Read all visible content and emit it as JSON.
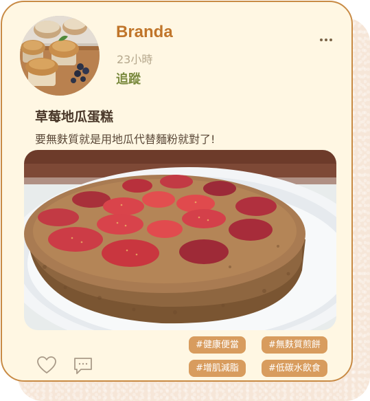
{
  "post": {
    "author": "Branda",
    "time": "23小時",
    "follow_label": "追蹤",
    "title": "草莓地瓜蛋糕",
    "body": "要無麩質就是用地瓜代替麵粉就對了!",
    "avatar_icon": "muffins-avatar-photo",
    "photo_icon": "strawberry-sweet-potato-cake-photo",
    "more_icon": "more-dots-icon"
  },
  "tags": [
    "#健康便當",
    "#無麩質煎餅",
    "#增肌減脂",
    "#低碳水飲食"
  ],
  "actions": {
    "like_icon": "heart-icon",
    "comment_icon": "comment-icon"
  },
  "colors": {
    "card_background": "#fff7e3",
    "card_border": "#c88a44",
    "author_name": "#c0752a",
    "follow": "#7a8a3e",
    "tag_background": "#d89c5e",
    "tag_text": "#ffffff"
  }
}
